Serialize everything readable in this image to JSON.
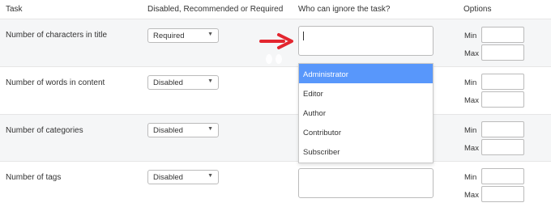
{
  "headers": {
    "task": "Task",
    "setting": "Disabled, Recommended or Required",
    "ignore": "Who can ignore the task?",
    "options": "Options"
  },
  "rows": [
    {
      "label": "Number of characters in title",
      "select": "Required",
      "min_label": "Min",
      "max_label": "Max"
    },
    {
      "label": "Number of words in content",
      "select": "Disabled",
      "min_label": "Min",
      "max_label": "Max"
    },
    {
      "label": "Number of categories",
      "select": "Disabled",
      "min_label": "Min",
      "max_label": "Max"
    },
    {
      "label": "Number of tags",
      "select": "Disabled",
      "min_label": "Min",
      "max_label": "Max"
    }
  ],
  "dropdown": {
    "options": [
      "Administrator",
      "Editor",
      "Author",
      "Contributor",
      "Subscriber"
    ],
    "highlighted": "Administrator"
  },
  "colors": {
    "highlight": "#5897fb",
    "arrow": "#e3262f",
    "alt_row": "#f5f6f7"
  },
  "icons": {
    "select_caret": "chevron-down-icon",
    "annotation": "red-arrow-icon"
  }
}
